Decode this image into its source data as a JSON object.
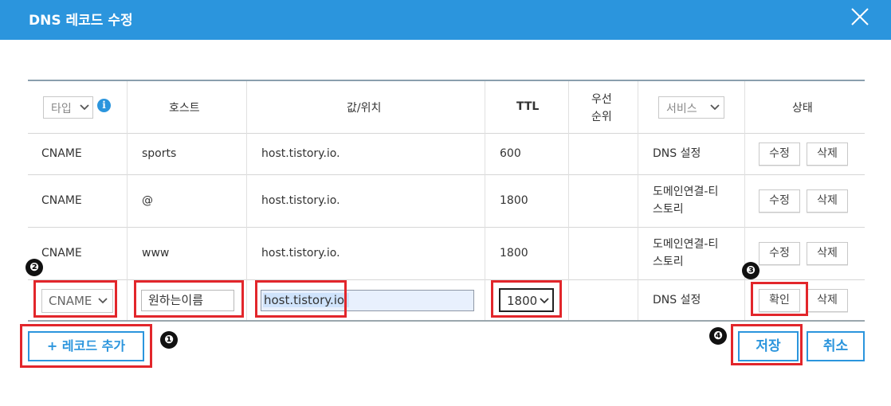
{
  "dialog": {
    "title": "DNS 레코드 수정",
    "close_icon": "close-icon"
  },
  "table": {
    "headers": {
      "type_label": "타입",
      "host": "호스트",
      "value": "값/위치",
      "ttl": "TTL",
      "priority_line1": "우선",
      "priority_line2": "순위",
      "service_label": "서비스",
      "status": "상태"
    },
    "rows": [
      {
        "type": "CNAME",
        "host": "sports",
        "value": "host.tistory.io.",
        "ttl": "600",
        "service_line1": "DNS 설정",
        "service_line2": "",
        "edit": "수정",
        "delete": "삭제"
      },
      {
        "type": "CNAME",
        "host": "@",
        "value": "host.tistory.io.",
        "ttl": "1800",
        "service_line1": "도메인연결-티",
        "service_line2": "스토리",
        "edit": "수정",
        "delete": "삭제"
      },
      {
        "type": "CNAME",
        "host": "www",
        "value": "host.tistory.io.",
        "ttl": "1800",
        "service_line1": "도메인연결-티",
        "service_line2": "스토리",
        "edit": "수정",
        "delete": "삭제"
      }
    ],
    "new_row": {
      "type_selected": "CNAME",
      "host_value": "원하는이름",
      "value_value": "host.tistory.io.",
      "ttl_selected": "1800",
      "service": "DNS 설정",
      "confirm": "확인",
      "delete": "삭제"
    }
  },
  "footer": {
    "add_record": "+ 레코드 추가",
    "save": "저장",
    "cancel": "취소"
  },
  "markers": [
    "❶",
    "❷",
    "❸",
    "❹"
  ],
  "colors": {
    "accent": "#2b95dd",
    "highlight": "#e2262b"
  }
}
